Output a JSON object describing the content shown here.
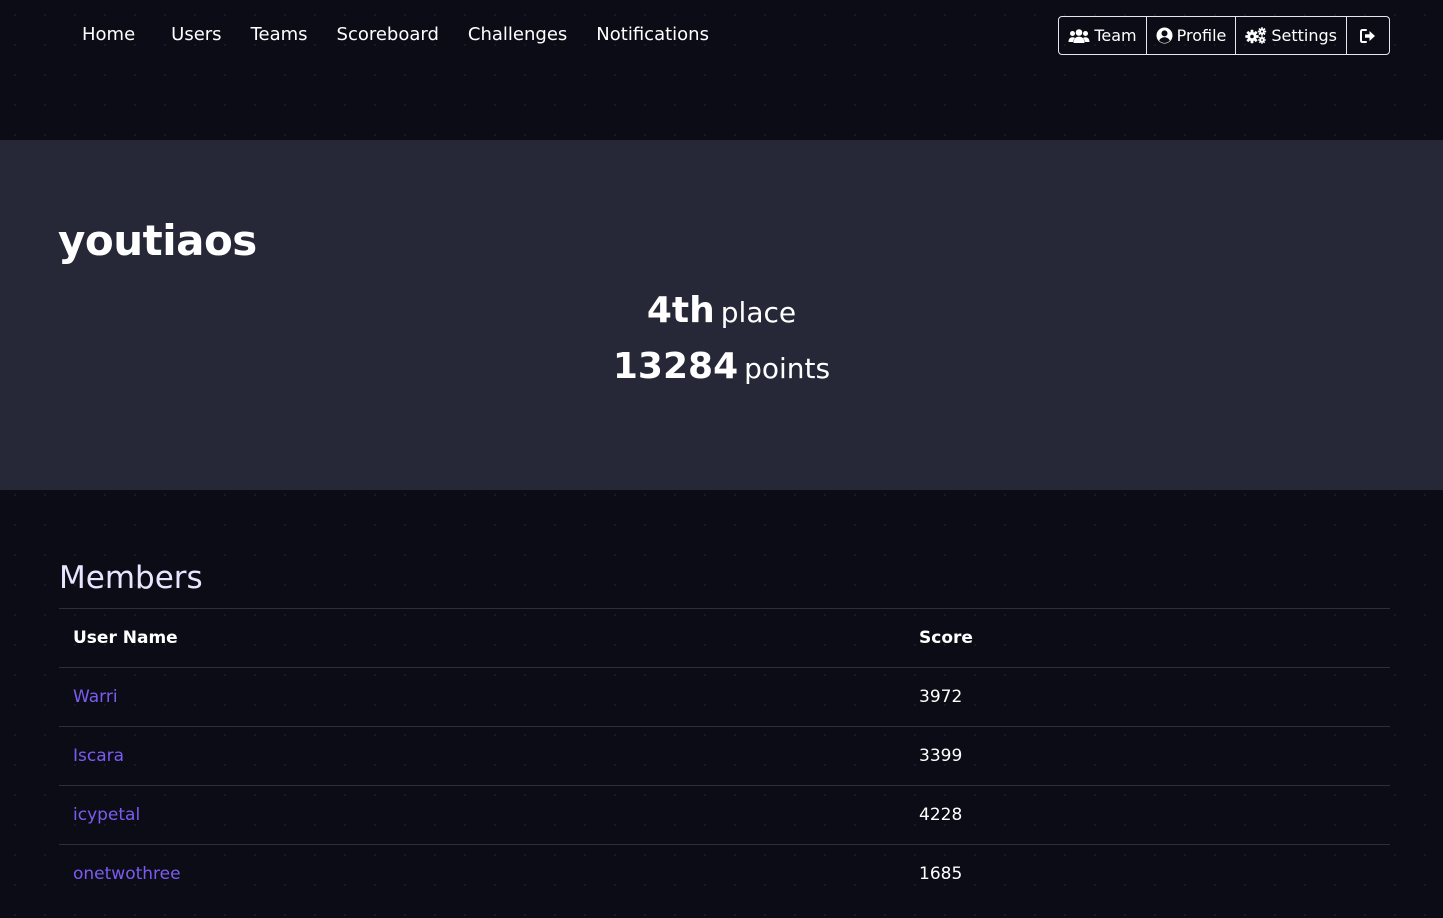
{
  "nav": {
    "links": [
      "Home",
      "Users",
      "Teams",
      "Scoreboard",
      "Challenges",
      "Notifications"
    ],
    "buttons": {
      "team": "Team",
      "profile": "Profile",
      "settings": "Settings",
      "logout_icon": "sign-out-icon"
    }
  },
  "team": {
    "name": "youtiaos",
    "place_value": "4th",
    "place_unit": "place",
    "points_value": "13284",
    "points_unit": "points"
  },
  "members": {
    "title": "Members",
    "columns": [
      "User Name",
      "Score"
    ],
    "rows": [
      {
        "name": "Warri",
        "score": "3972"
      },
      {
        "name": "Iscara",
        "score": "3399"
      },
      {
        "name": "icypetal",
        "score": "4228"
      },
      {
        "name": "onetwothree",
        "score": "1685"
      }
    ]
  },
  "colors": {
    "background": "#0c0c17",
    "jumbotron": "#262838",
    "link": "#7b5cf0",
    "text": "#ffffff"
  }
}
